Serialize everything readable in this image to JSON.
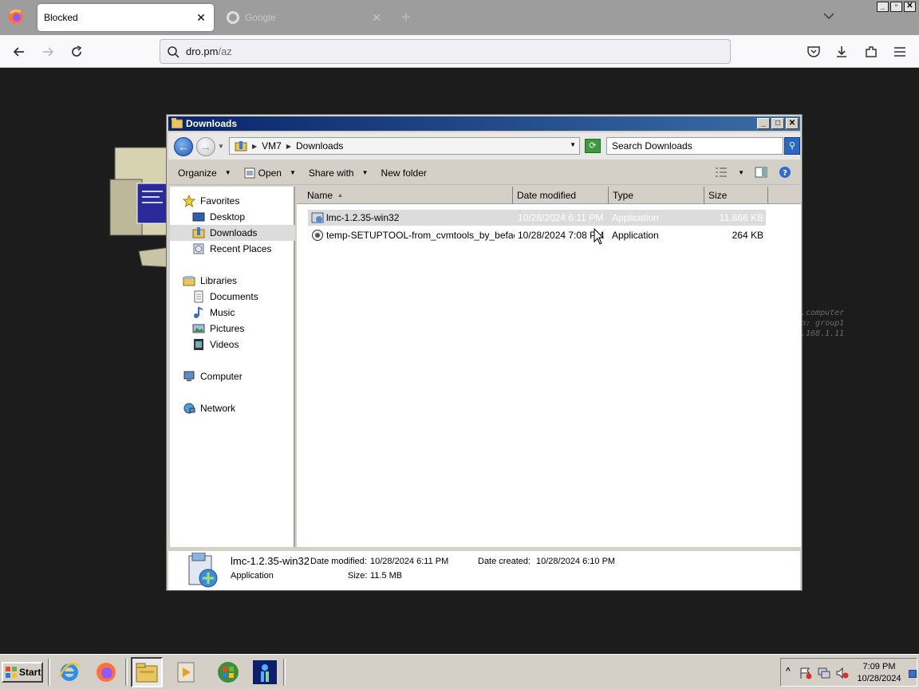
{
  "browser": {
    "tabs": [
      {
        "title": "Blocked",
        "active": true
      },
      {
        "title": "Google",
        "active": false
      }
    ],
    "url": {
      "host": "dro.pm",
      "path": "/az"
    }
  },
  "background": {
    "terminal_lines": [
      ".computer",
      "p: group1",
      ".168.1.11"
    ]
  },
  "explorer": {
    "title": "Downloads",
    "breadcrumb": [
      "VM7",
      "Downloads"
    ],
    "search_placeholder": "Search Downloads",
    "toolbar": {
      "organize": "Organize",
      "open": "Open",
      "share_with": "Share with",
      "new_folder": "New folder"
    },
    "nav": {
      "favorites": "Favorites",
      "desktop": "Desktop",
      "downloads": "Downloads",
      "recent_places": "Recent Places",
      "libraries": "Libraries",
      "documents": "Documents",
      "music": "Music",
      "pictures": "Pictures",
      "videos": "Videos",
      "computer": "Computer",
      "network": "Network"
    },
    "columns": {
      "name": "Name",
      "date_modified": "Date modified",
      "type": "Type",
      "size": "Size"
    },
    "files": [
      {
        "name": "lmc-1.2.35-win32",
        "date": "10/28/2024 6:11 PM",
        "type": "Application",
        "size": "11,866 KB",
        "selected": true
      },
      {
        "name": "temp-SETUPTOOL-from_cvmtools_by_befaci",
        "date": "10/28/2024 7:08 PM",
        "type": "Application",
        "size": "264 KB",
        "selected": false
      }
    ],
    "details": {
      "name": "lmc-1.2.35-win32",
      "type": "Application",
      "modified_label": "Date modified:",
      "modified_value": "10/28/2024 6:11 PM",
      "created_label": "Date created:",
      "created_value": "10/28/2024 6:10 PM",
      "size_label": "Size:",
      "size_value": "11.5 MB"
    }
  },
  "taskbar": {
    "start_label": "Start",
    "clock_time": "7:09 PM",
    "clock_date": "10/28/2024"
  },
  "colors": {
    "title_gradient_start": "#0a246a",
    "title_gradient_end": "#3a6ea5",
    "classic_face": "#d4d0c8",
    "page_background": "#1c1c1c"
  }
}
